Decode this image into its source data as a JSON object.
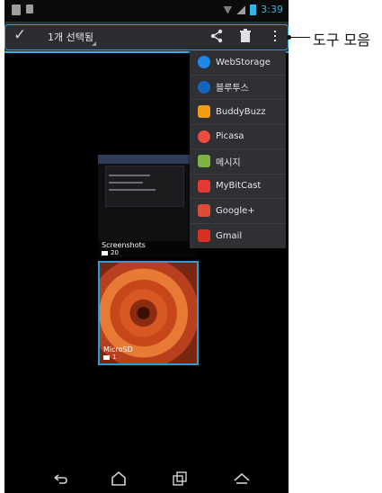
{
  "status_bar": {
    "time": "3:39"
  },
  "action_bar": {
    "selection_count": "1개 선택됨",
    "icons": [
      "check-icon",
      "share-icon",
      "trash-icon",
      "more-vert-icon"
    ]
  },
  "share_menu": {
    "items": [
      {
        "label": "WebStorage",
        "icon": "webstorage-icon",
        "color": "#1e88e5"
      },
      {
        "label": "블루투스",
        "icon": "bluetooth-icon",
        "color": "#1565c0"
      },
      {
        "label": "BuddyBuzz",
        "icon": "buddybuzz-icon",
        "color": "#f39c12"
      },
      {
        "label": "Picasa",
        "icon": "picasa-icon",
        "color": "#e74c3c"
      },
      {
        "label": "메시지",
        "icon": "message-icon",
        "color": "#7cb342"
      },
      {
        "label": "MyBitCast",
        "icon": "mybitcast-icon",
        "color": "#e53935"
      },
      {
        "label": "Google+",
        "icon": "googleplus-icon",
        "color": "#dd4b39"
      },
      {
        "label": "Gmail",
        "icon": "gmail-icon",
        "color": "#d93025"
      }
    ]
  },
  "albums": [
    {
      "name": "Screenshots",
      "count": "20"
    },
    {
      "name": "MicroSD",
      "count": "1"
    }
  ],
  "callout": {
    "label": "도구 모음"
  },
  "colors": {
    "accent": "#33b5e5",
    "action_bar": "#2b2d30",
    "menu_bg": "#2f3033"
  }
}
